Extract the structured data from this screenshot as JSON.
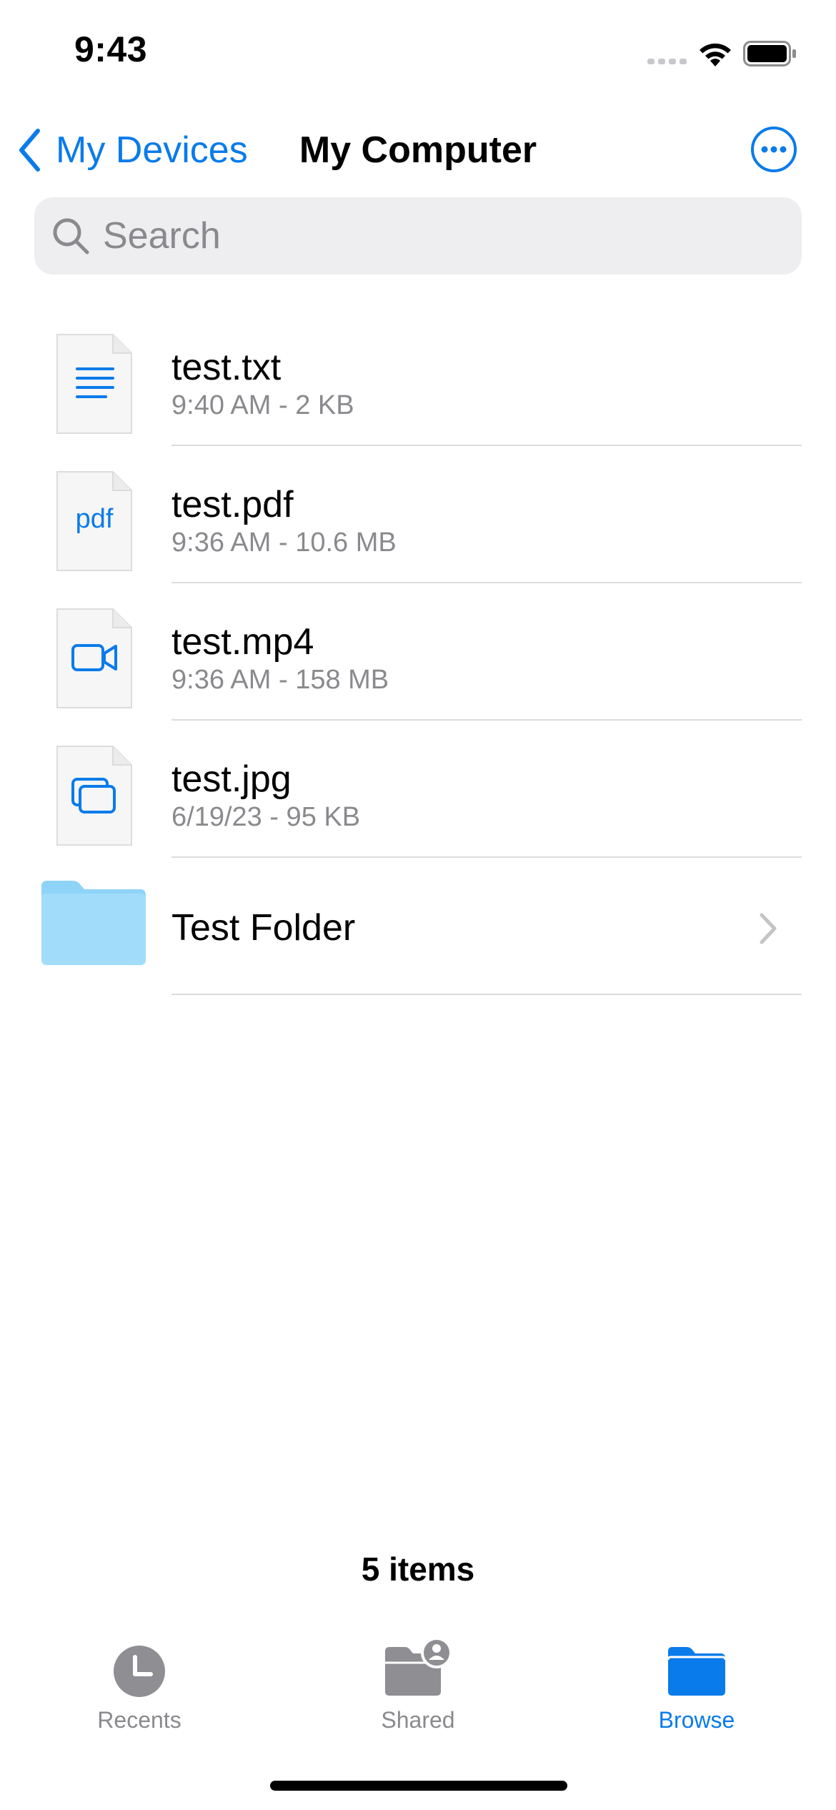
{
  "status_bar": {
    "time": "9:43"
  },
  "nav": {
    "back_label": "My Devices",
    "title": "My Computer"
  },
  "search": {
    "placeholder": "Search",
    "value": ""
  },
  "items": [
    {
      "name": "test.txt",
      "meta": "9:40 AM - 2 KB",
      "icon": "text-document-icon"
    },
    {
      "name": "test.pdf",
      "meta": "9:36 AM - 10.6 MB",
      "icon": "pdf-document-icon",
      "icon_text": "pdf"
    },
    {
      "name": "test.mp4",
      "meta": "9:36 AM - 158 MB",
      "icon": "video-document-icon"
    },
    {
      "name": "test.jpg",
      "meta": "6/19/23 - 95 KB",
      "icon": "image-document-icon"
    },
    {
      "name": "Test Folder",
      "icon": "folder-icon"
    }
  ],
  "footer": {
    "count": "5 items"
  },
  "tabs": [
    {
      "label": "Recents",
      "icon": "clock-icon",
      "active": false
    },
    {
      "label": "Shared",
      "icon": "shared-folder-icon",
      "active": false
    },
    {
      "label": "Browse",
      "icon": "folder-icon",
      "active": true
    }
  ],
  "colors": {
    "accent": "#0a7bea",
    "secondary_text": "#8a8a8e",
    "separator": "#dcdcdf",
    "folder": "#8fd3f8"
  }
}
